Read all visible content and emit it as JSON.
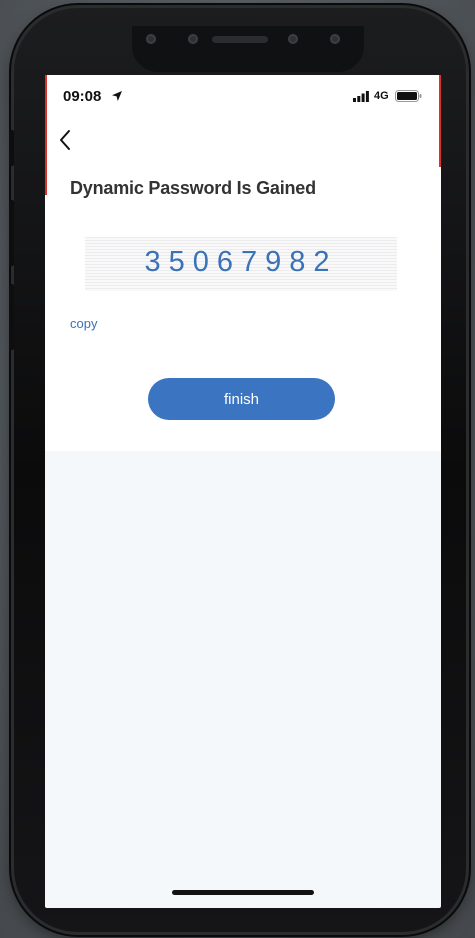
{
  "status_bar": {
    "time": "09:08",
    "network": "4G",
    "location_icon": "location-arrow-icon",
    "signal_icon": "signal-bars-icon",
    "battery_icon": "battery-icon"
  },
  "nav": {
    "back_icon": "chevron-left-icon"
  },
  "main": {
    "title": "Dynamic Password Is Gained",
    "password": "35067982",
    "copy_label": "copy",
    "finish_label": "finish"
  },
  "colors": {
    "accent": "#3b74c0",
    "link": "#3a72b8",
    "title": "#333333",
    "screen_background": "#f4f8fa"
  }
}
